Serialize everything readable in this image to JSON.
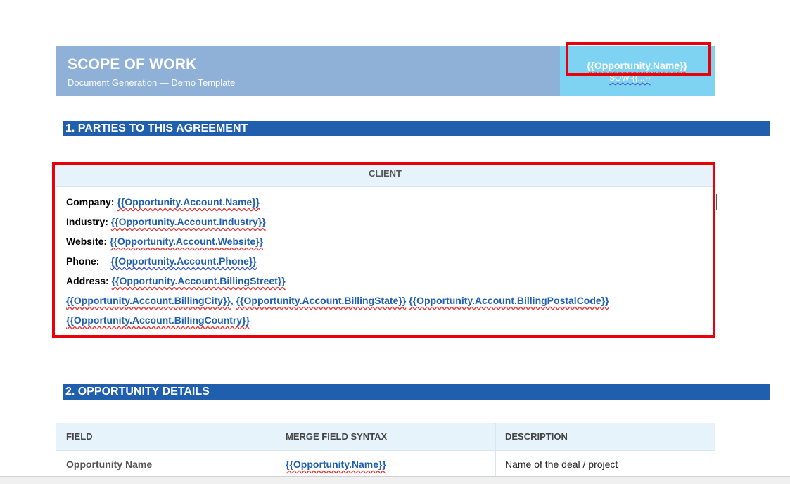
{
  "header": {
    "title": "SCOPE OF WORK",
    "subtitle": "Document Generation — Demo Template",
    "opportunity_name": "{{Opportunity.Name}}",
    "sow_ref": "SOW-{{...}}"
  },
  "sections": {
    "s1": "1.  PARTIES TO THIS AGREEMENT",
    "s2": "2.  OPPORTUNITY DETAILS"
  },
  "client": {
    "heading": "CLIENT",
    "company_label": "Company:",
    "company_value": "{{Opportunity.Account.Name}}",
    "industry_label": "Industry:",
    "industry_value": "{{Opportunity.Account.Industry}}",
    "website_label": "Website:",
    "website_value": "{{Opportunity.Account.Website}}",
    "phone_label": "Phone:",
    "phone_value": "{{Opportunity.Account.Phone}}",
    "address_label": "Address:",
    "address_street": "{{Opportunity.Account.BillingStreet}}",
    "address_city": "{{Opportunity.Account.BillingCity}}",
    "address_sep1": ", ",
    "address_state": "{{Opportunity.Account.BillingState}}",
    "address_postal": "{{Opportunity.Account.BillingPostalCode}}",
    "address_country": "{{Opportunity.Account.BillingCountry}}"
  },
  "details_table": {
    "headers": [
      "FIELD",
      "MERGE FIELD SYNTAX",
      "DESCRIPTION"
    ],
    "rows": [
      {
        "field": "Opportunity Name",
        "syntax": "{{Opportunity.Name}}",
        "description": "Name of the deal / project"
      }
    ]
  },
  "colors": {
    "banner": "#8fb1d7",
    "banner_accent": "#7fd3f2",
    "section": "#1f5fae",
    "highlight": "#e8000a",
    "merge_field": "#1f5fae"
  }
}
